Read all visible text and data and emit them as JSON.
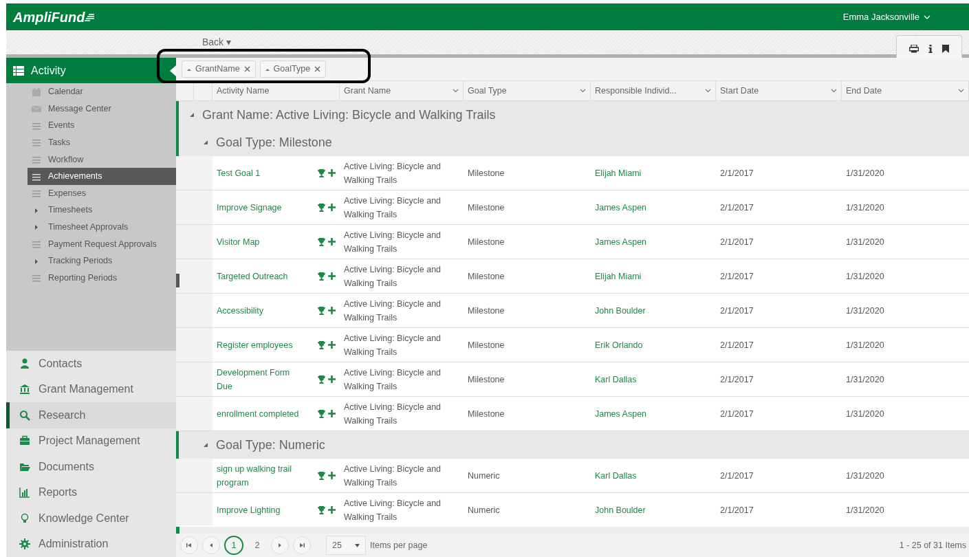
{
  "app": {
    "logo": "AmpliFund",
    "user": "Emma Jacksonville"
  },
  "toolbar": {
    "back": "Back ▾"
  },
  "sidebar": {
    "section": "Activity",
    "items": [
      {
        "label": "Calendar",
        "kind": "calendar",
        "selected": false
      },
      {
        "label": "Message Center",
        "kind": "message",
        "selected": false
      },
      {
        "label": "Events",
        "kind": "list",
        "selected": false
      },
      {
        "label": "Tasks",
        "kind": "list",
        "selected": false
      },
      {
        "label": "Workflow",
        "kind": "list",
        "selected": false
      },
      {
        "label": "Achievements",
        "kind": "list",
        "selected": true
      },
      {
        "label": "Expenses",
        "kind": "list",
        "selected": false
      },
      {
        "label": "Timesheets",
        "kind": "expandable",
        "selected": false
      },
      {
        "label": "Timesheet Approvals",
        "kind": "expandable",
        "selected": false
      },
      {
        "label": "Payment Request Approvals",
        "kind": "list",
        "selected": false
      },
      {
        "label": "Tracking Periods",
        "kind": "expandable",
        "selected": false
      },
      {
        "label": "Reporting Periods",
        "kind": "list",
        "selected": false
      }
    ],
    "modules": [
      {
        "label": "Contacts",
        "kind": "person",
        "selected": false
      },
      {
        "label": "Grant Management",
        "kind": "bank",
        "selected": false
      },
      {
        "label": "Research",
        "kind": "search",
        "selected": true
      },
      {
        "label": "Project Management",
        "kind": "briefcase",
        "selected": false
      },
      {
        "label": "Documents",
        "kind": "folder",
        "selected": false
      },
      {
        "label": "Reports",
        "kind": "chart",
        "selected": false
      },
      {
        "label": "Knowledge Center",
        "kind": "bulb",
        "selected": false
      },
      {
        "label": "Administration",
        "kind": "gear",
        "selected": false
      }
    ]
  },
  "grouping": [
    {
      "label": "GrantName"
    },
    {
      "label": "GoalType"
    }
  ],
  "table": {
    "columns": [
      "Activity Name",
      "Grant Name",
      "Goal Type",
      "Responsible Individ...",
      "Start Date",
      "End Date"
    ],
    "groups": [
      {
        "label": "Grant Name: Active Living: Bicycle and Walking Trails",
        "expanded": true,
        "children": [
          {
            "label": "Goal Type: Milestone",
            "expanded": true,
            "rows": [
              [
                "Test Goal 1",
                "Active Living: Bicycle and Walking Trails",
                "Milestone",
                "Elijah Miami",
                "2/1/2017",
                "1/31/2020"
              ],
              [
                "Improve Signage",
                "Active Living: Bicycle and Walking Trails",
                "Milestone",
                "James Aspen",
                "2/1/2017",
                "1/31/2020"
              ],
              [
                "Visitor Map",
                "Active Living: Bicycle and Walking Trails",
                "Milestone",
                "James Aspen",
                "2/1/2017",
                "1/31/2020"
              ],
              [
                "Targeted Outreach",
                "Active Living: Bicycle and Walking Trails",
                "Milestone",
                "Elijah Miami",
                "2/1/2017",
                "1/31/2020"
              ],
              [
                "Accessibility",
                "Active Living: Bicycle and Walking Trails",
                "Milestone",
                "John Boulder",
                "2/1/2017",
                "1/31/2020"
              ],
              [
                "Register employees",
                "Active Living: Bicycle and Walking Trails",
                "Milestone",
                "Erik Orlando",
                "2/1/2017",
                "1/31/2020"
              ],
              [
                "Development Form Due",
                "Active Living: Bicycle and Walking Trails",
                "Milestone",
                "Karl Dallas",
                "2/1/2017",
                "1/31/2020"
              ],
              [
                "enrollment completed",
                "Active Living: Bicycle and Walking Trails",
                "Milestone",
                "James Aspen",
                "2/1/2017",
                "1/31/2020"
              ]
            ]
          },
          {
            "label": "Goal Type: Numeric",
            "expanded": true,
            "rows": [
              [
                "sign up walking trail program",
                "Active Living: Bicycle and Walking Trails",
                "Numeric",
                "Karl Dallas",
                "2/1/2017",
                "1/31/2020"
              ],
              [
                "Improve Lighting",
                "Active Living: Bicycle and Walking Trails",
                "Numeric",
                "John Boulder",
                "2/1/2017",
                "1/31/2020"
              ]
            ]
          }
        ]
      }
    ]
  },
  "pager": {
    "pages": [
      {
        "label": "1",
        "selected": true
      },
      {
        "label": "2",
        "selected": false
      }
    ],
    "page_size": "25",
    "page_size_label": "Items per page",
    "summary": "1 - 25 of 31 Items"
  }
}
